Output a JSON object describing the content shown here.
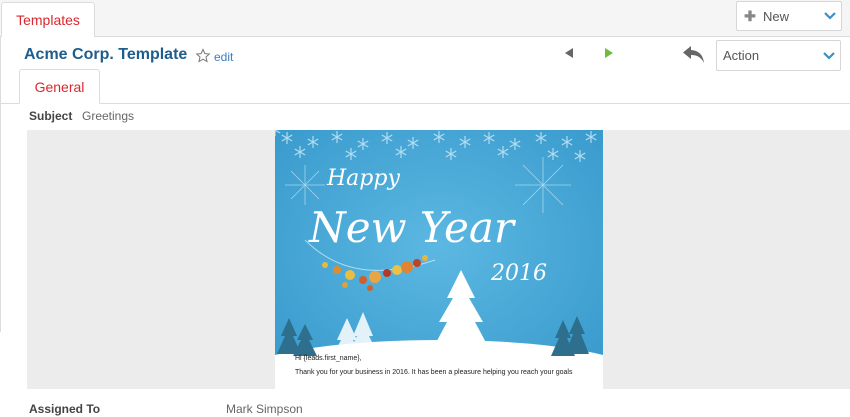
{
  "module_tab": {
    "label": "Templates"
  },
  "toolbar": {
    "new_label": "New",
    "action_label": "Action"
  },
  "record": {
    "title": "Acme Corp. Template",
    "edit_label": "edit"
  },
  "tabs": [
    {
      "label": "General"
    }
  ],
  "fields": {
    "subject_label": "Subject",
    "subject_value": "Greetings",
    "assigned_label": "Assigned To",
    "assigned_value": "Mark Simpson"
  },
  "email": {
    "happy": "Happy",
    "new_year": "New Year",
    "year": "2016",
    "greeting": "Hi {leads.first_name},",
    "body": "Thank you for your business in 2016. It has been a pleasure helping you reach your goals"
  },
  "icons": {
    "star": "star-icon",
    "prev": "prev-arrow-icon",
    "next": "next-arrow-icon",
    "undo": "undo-icon",
    "plus": "plus-icon",
    "chevron": "chevron-down-icon"
  },
  "colors": {
    "accent_red": "#d9272e",
    "title_blue": "#1f5d8c",
    "next_green": "#6dbb3f",
    "card_blue": "#44a6d5"
  }
}
